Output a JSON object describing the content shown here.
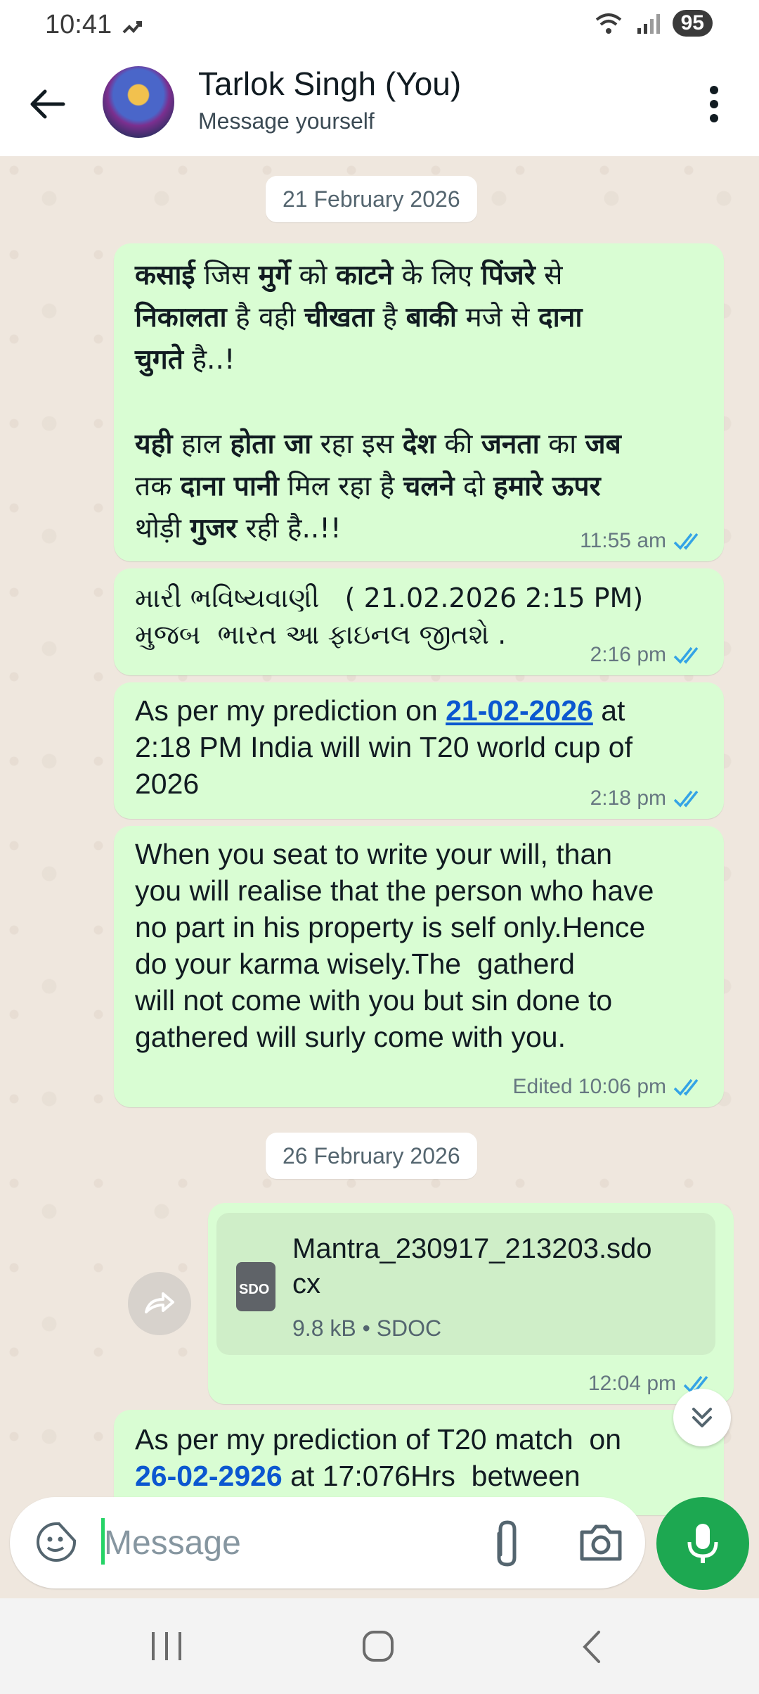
{
  "status_bar": {
    "time": "10:41",
    "battery": "95"
  },
  "header": {
    "title": "Tarlok Singh (You)",
    "subtitle": "Message yourself"
  },
  "dates": {
    "first": "21 February 2026",
    "second": "26 February 2026"
  },
  "messages": [
    {
      "time": "11:55 am",
      "status": "read"
    },
    {
      "line1": "મારી ભવિષ્યવાણી   ( 21.02.2026 2:15 PM)",
      "line2": "મુજબ  ભારત આ ફાઇનલ જીતશે .",
      "time": "2:16 pm",
      "status": "read"
    },
    {
      "pre": "As per my prediction on ",
      "link": "21-02-2026",
      "post": " at\n2:18 PM India will win T20 world cup of\n2026",
      "time": "2:18 pm",
      "status": "read"
    },
    {
      "text": "When you seat to write your will, than\nyou will realise that the person who have\nno part in his property is self only.Hence\ndo your karma wisely.The  gatherd\nwill not come with you but sin done to\ngathered will surly come with you.",
      "time": "Edited 10:06 pm",
      "status": "read"
    },
    {
      "file_name": "Mantra_230917_213203.sdo\ncx",
      "file_meta": "9.8 kB • SDOC",
      "file_type_label": "SDO",
      "time": "12:04 pm",
      "status": "read"
    },
    {
      "line1": "As per my prediction of T20 match  on",
      "link": "26-02-2926",
      "line2_post": " at 17:076Hrs  between"
    }
  ],
  "hindi_message": {
    "w1": "कसाई",
    "t1": " जिस ",
    "w2": "मुर्गे",
    "t2": " को ",
    "w3": "काटने",
    "t3": " के लिए ",
    "w4": "पिंजरे",
    "t4": " से",
    "w5": "निकालता",
    "t5": " है वही ",
    "w6": "चीखता",
    "t6": " है ",
    "w7": "बाकी",
    "t7": " मजे से ",
    "w8": "दाना",
    "w9": "चुगते",
    "t9": " है..!",
    "w10": "यही",
    "t10": " हाल ",
    "w11": "होता जा",
    "t11": " रहा इस ",
    "w12": "देश",
    "t12": " की ",
    "w13": "जनता",
    "t13": " का ",
    "w14": "जब",
    "t14": "तक ",
    "w15": "दाना पानी",
    "t15": " मिल रहा है ",
    "w16": "चलने",
    "t16": " दो ",
    "w17": "हमारे ऊपर",
    "t17": "थोड़ी ",
    "w18": "गुजर",
    "t18": " रही है..!!"
  },
  "composer": {
    "placeholder": "Message"
  },
  "colors": {
    "bubble_out": "#d9fdd3",
    "accent_green": "#1da851",
    "read_ticks": "#34a3e6",
    "link": "#0b57d0"
  },
  "icons": {
    "back": "arrow-left-icon",
    "menu": "kebab-menu-icon",
    "emoji": "sticker-icon",
    "attach": "paperclip-icon",
    "camera": "camera-icon",
    "mic": "mic-icon",
    "share": "forward-icon",
    "scroll": "double-chevron-down-icon"
  }
}
